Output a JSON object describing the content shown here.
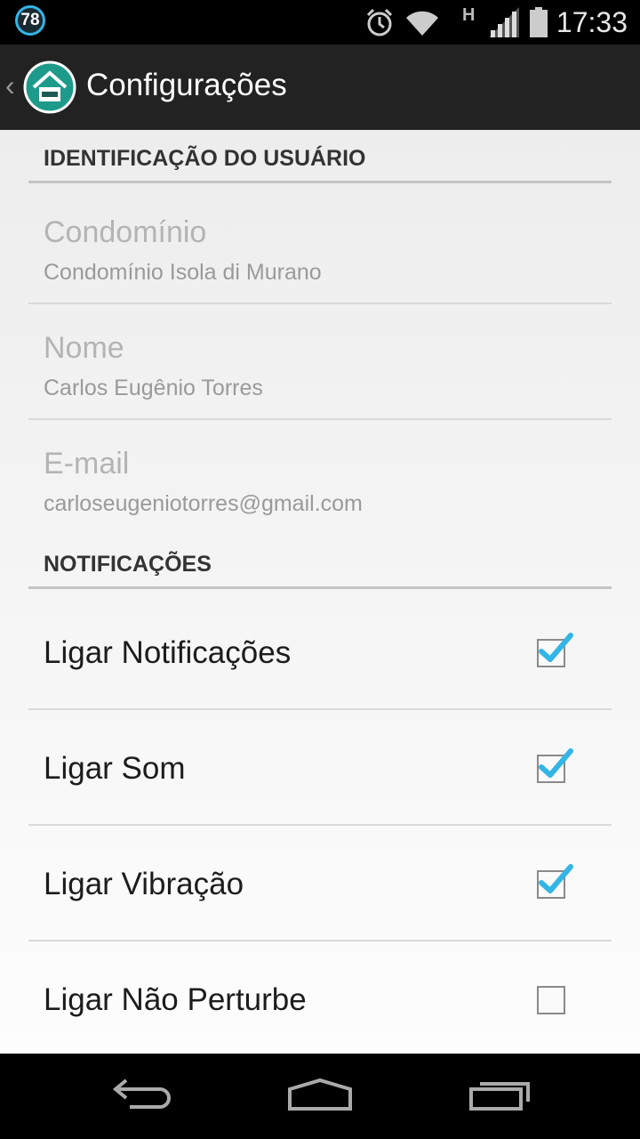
{
  "status_bar": {
    "notification_count": "78",
    "network_type": "H",
    "time": "17:33",
    "accent": "#33b5e5"
  },
  "action_bar": {
    "title": "Configurações",
    "up_icon": "back-caret-icon",
    "app_icon": "house-icon"
  },
  "sections": {
    "user_id_header": "IDENTIFICAÇÃO DO USUÁRIO",
    "notifications_header": "NOTIFICAÇÕES"
  },
  "user_fields": [
    {
      "title": "Condomínio",
      "value": "Condomínio Isola di Murano"
    },
    {
      "title": "Nome",
      "value": "Carlos Eugênio Torres"
    },
    {
      "title": "E-mail",
      "value": "carloseugeniotorres@gmail.com"
    }
  ],
  "toggles": [
    {
      "label": "Ligar Notificações",
      "checked": true
    },
    {
      "label": "Ligar Som",
      "checked": true
    },
    {
      "label": "Ligar Vibração",
      "checked": true
    },
    {
      "label": "Ligar Não Perturbe",
      "checked": false
    }
  ],
  "nav_bar": {
    "back_icon": "back-icon",
    "home_icon": "home-icon",
    "recents_icon": "recents-icon"
  }
}
